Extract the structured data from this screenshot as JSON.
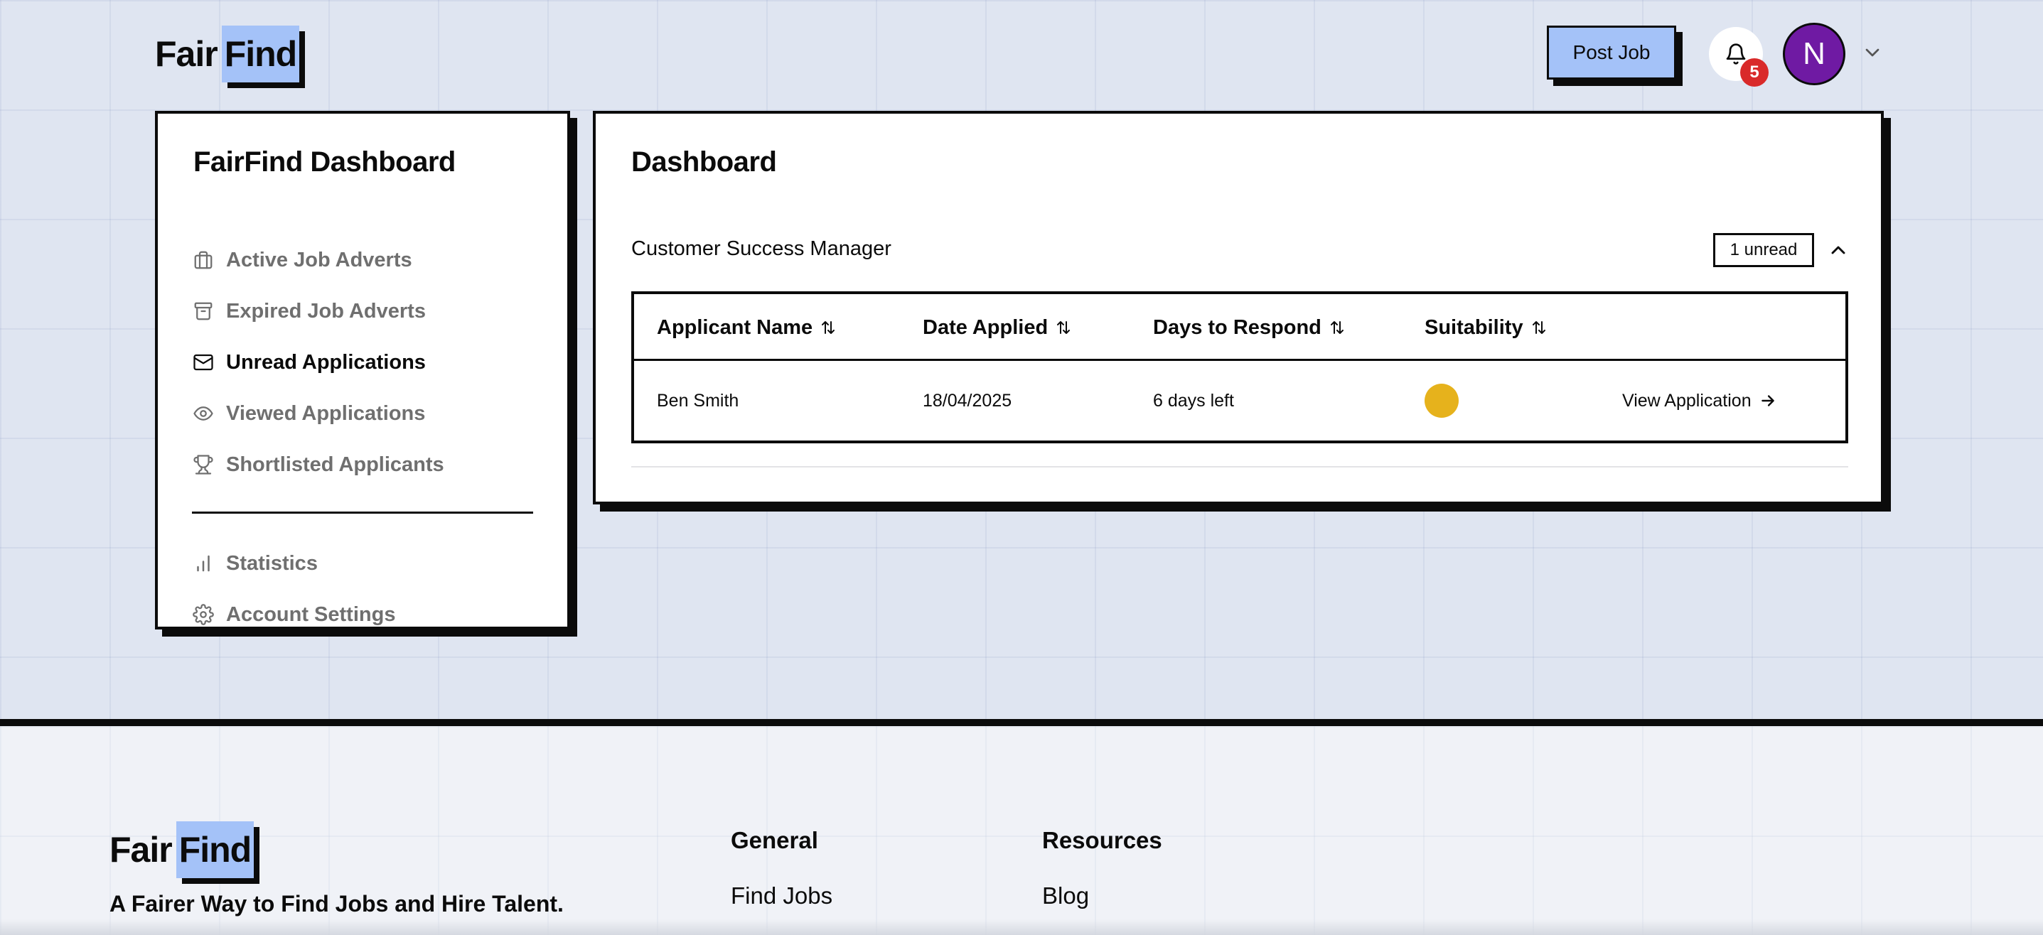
{
  "brand": {
    "word_a": "Fair",
    "word_b": "Find",
    "highlight_color": "#a4c2f8"
  },
  "header": {
    "post_job_label": "Post Job",
    "notification_count": "5",
    "avatar_initial": "N"
  },
  "sidebar": {
    "title": "FairFind Dashboard",
    "items": [
      {
        "label": "Active Job Adverts",
        "icon": "briefcase-icon",
        "active": false
      },
      {
        "label": "Expired Job Adverts",
        "icon": "archive-icon",
        "active": false
      },
      {
        "label": "Unread Applications",
        "icon": "envelope-icon",
        "active": true
      },
      {
        "label": "Viewed Applications",
        "icon": "eye-icon",
        "active": false
      },
      {
        "label": "Shortlisted Applicants",
        "icon": "trophy-icon",
        "active": false
      }
    ],
    "secondary_items": [
      {
        "label": "Statistics",
        "icon": "bar-chart-icon"
      },
      {
        "label": "Account Settings",
        "icon": "gear-icon"
      }
    ]
  },
  "main": {
    "title": "Dashboard",
    "job": {
      "title": "Customer Success Manager",
      "unread_badge": "1 unread"
    },
    "table": {
      "columns": [
        "Applicant Name",
        "Date Applied",
        "Days to Respond",
        "Suitability"
      ],
      "rows": [
        {
          "applicant_name": "Ben Smith",
          "date_applied": "18/04/2025",
          "days_to_respond": "6 days left",
          "suitability_color": "#e6b21c",
          "action_label": "View Application"
        }
      ]
    }
  },
  "footer": {
    "tagline": "A Fairer Way to Find Jobs and Hire Talent.",
    "columns": [
      {
        "title": "General",
        "links": [
          "Find Jobs"
        ]
      },
      {
        "title": "Resources",
        "links": [
          "Blog"
        ]
      }
    ]
  },
  "colors": {
    "accent": "#a4c2f8",
    "avatar": "#6f1aa3",
    "badge": "#d92a2a",
    "suitability": "#e6b21c"
  }
}
